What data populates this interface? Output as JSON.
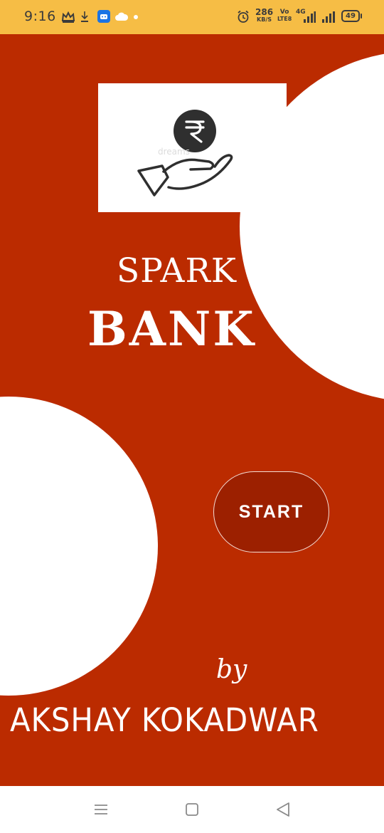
{
  "status_bar": {
    "time": "9:16",
    "net_speed_value": "286",
    "net_speed_unit": "KB/S",
    "volte_top": "Vo",
    "volte_bottom": "LTE8",
    "network_type": "4G",
    "battery": "49",
    "icons": [
      "crown-icon",
      "download-icon",
      "app-icon",
      "cloud-icon",
      "dot-icon",
      "alarm-icon",
      "signal-icon",
      "signal-icon",
      "battery-icon"
    ],
    "background": "#f6bd45"
  },
  "app": {
    "background": "#bb2b00",
    "title_line1": "SPARK",
    "title_line2": "BANK",
    "logo_icon": "rupee-coin-hand-icon",
    "logo_watermark": "dreams",
    "start_label": "START",
    "by_label": "by",
    "author": "AKSHAY KOKADWAR"
  },
  "nav_bar": {
    "icons": [
      "menu-icon",
      "home-square-icon",
      "back-triangle-icon"
    ]
  }
}
